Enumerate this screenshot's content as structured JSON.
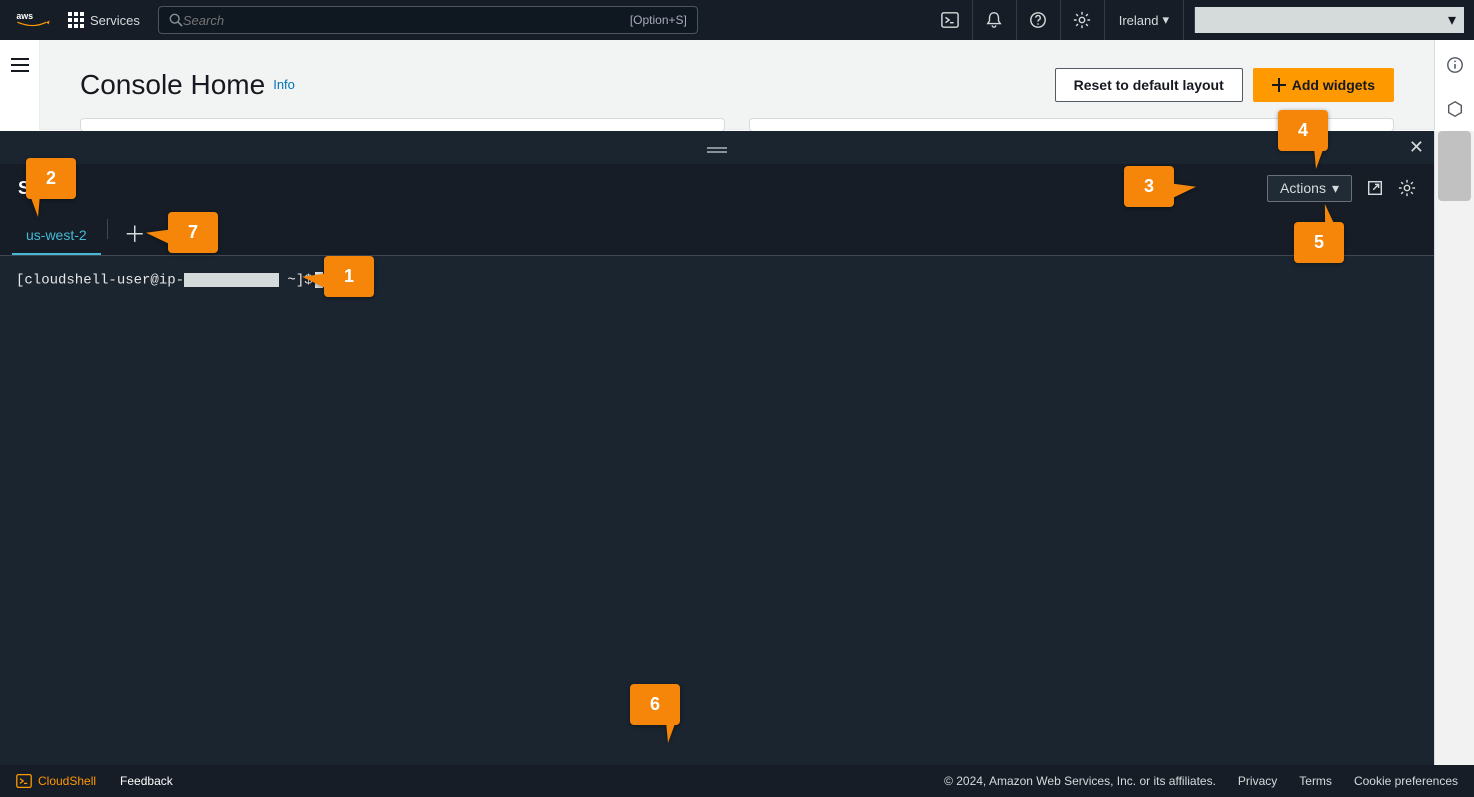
{
  "nav": {
    "logo_text": "aws",
    "services_label": "Services",
    "search_placeholder": "Search",
    "search_hint": "[Option+S]",
    "region": "Ireland"
  },
  "console": {
    "title": "Console Home",
    "info": "Info",
    "reset_btn": "Reset to default layout",
    "add_btn": "Add widgets"
  },
  "shell": {
    "title_suffix": "Shell",
    "actions": "Actions",
    "tab": "us-west-2",
    "prompt_prefix": "[cloudshell-user@ip-",
    "prompt_suffix": " ~]$"
  },
  "footer": {
    "cloudshell": "CloudShell",
    "feedback": "Feedback",
    "copyright": "© 2024, Amazon Web Services, Inc. or its affiliates.",
    "privacy": "Privacy",
    "terms": "Terms",
    "cookies": "Cookie preferences"
  },
  "callouts": {
    "c1": "1",
    "c2": "2",
    "c3": "3",
    "c4": "4",
    "c5": "5",
    "c6": "6",
    "c7": "7"
  }
}
